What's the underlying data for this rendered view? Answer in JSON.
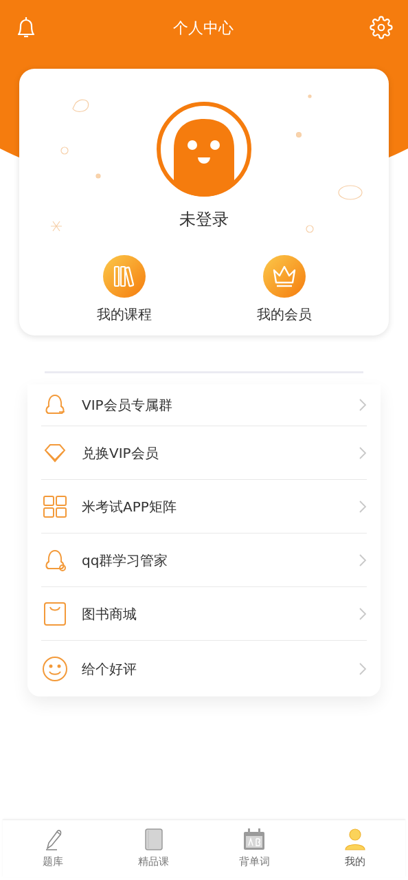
{
  "header": {
    "title": "个人中心"
  },
  "profile": {
    "name": "未登录"
  },
  "quick_links": [
    {
      "kind": "books",
      "label": "我的课程"
    },
    {
      "kind": "crown",
      "label": "我的会员"
    }
  ],
  "menu": [
    {
      "kind": "vip-group",
      "label": "VIP会员专属群"
    },
    {
      "kind": "diamond",
      "label": "兑换VIP会员"
    },
    {
      "kind": "grid",
      "label": "米考试APP矩阵"
    },
    {
      "kind": "chat-group",
      "label": "qq群学习管家"
    },
    {
      "kind": "bag",
      "label": "图书商城"
    },
    {
      "kind": "smile",
      "label": "给个好评"
    }
  ],
  "tabs": [
    {
      "kind": "pencil",
      "label": "题库",
      "selected": false
    },
    {
      "kind": "book",
      "label": "精品课",
      "selected": false
    },
    {
      "kind": "calendar",
      "label": "背单词",
      "selected": false
    },
    {
      "kind": "person",
      "label": "我的",
      "selected": true
    }
  ]
}
